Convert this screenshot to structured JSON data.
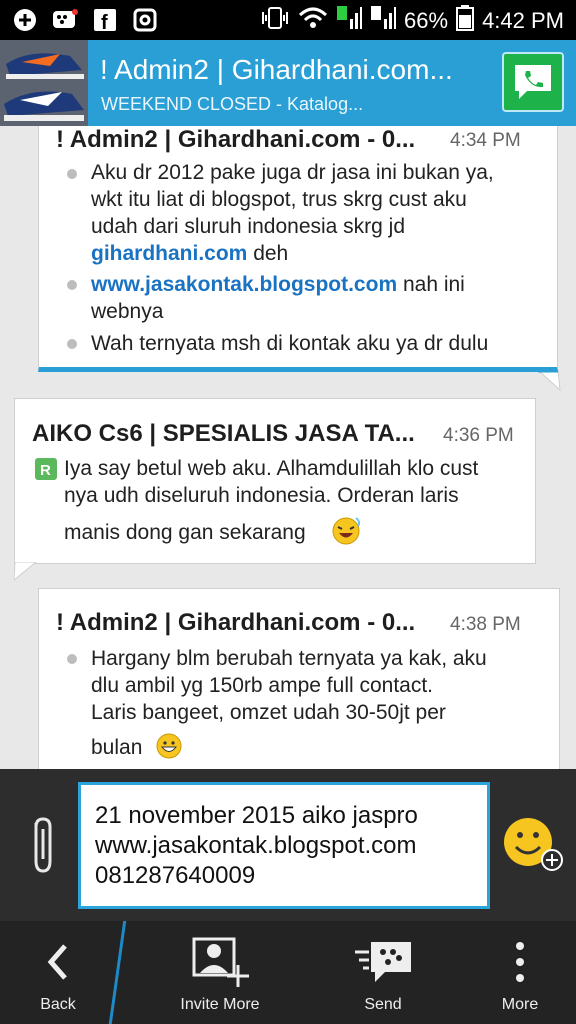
{
  "status_bar": {
    "battery": "66%",
    "time": "4:42 PM"
  },
  "header": {
    "title": "! Admin2 | Gihardhani.com...",
    "subtitle": "WEEKEND CLOSED - Katalog..."
  },
  "messages": [
    {
      "sender": "! Admin2 | Gihardhani.com - 0...",
      "time": "4:34 PM",
      "lines": [
        {
          "bullet": true,
          "text": "Aku dr 2012 pake juga dr jasa ini bukan ya,"
        },
        {
          "bullet": false,
          "text": "wkt itu liat di blogspot, trus skrg cust aku"
        },
        {
          "bullet": false,
          "text": "udah dari sluruh indonesia skrg jd"
        },
        {
          "bullet": false,
          "link": "gihardhani.com",
          "text": " deh"
        },
        {
          "bullet": true,
          "link": "www.jasakontak.blogspot.com",
          "text": " nah ini"
        },
        {
          "bullet": false,
          "text": "webnya"
        },
        {
          "bullet": true,
          "text": "Wah ternyata msh di kontak aku ya dr dulu"
        }
      ]
    },
    {
      "sender": "AIKO Cs6 | SPESIALIS JASA TA...",
      "time": "4:36 PM",
      "lines": [
        {
          "text": "Iya say betul web aku. Alhamdulillah klo cust"
        },
        {
          "text": "nya udh diseluruh indonesia. Orderan laris"
        },
        {
          "text": "manis dong gan sekarang"
        }
      ]
    },
    {
      "sender": "! Admin2 | Gihardhani.com - 0...",
      "time": "4:38 PM",
      "lines": [
        {
          "bullet": true,
          "text": "Hargany blm berubah ternyata ya kak, aku"
        },
        {
          "bullet": false,
          "text": "dlu ambil yg 150rb ampe full contact."
        },
        {
          "bullet": false,
          "text": "Laris bangeet, omzet udah 30-50jt per"
        },
        {
          "bullet": false,
          "text": "bulan"
        }
      ]
    }
  ],
  "compose": {
    "lines": [
      "21 november 2015 aiko jaspro",
      "www.jasakontak.blogspot.com",
      "081287640009"
    ]
  },
  "bottom_nav": {
    "back": "Back",
    "invite": "Invite More",
    "send": "Send",
    "more": "More"
  },
  "colors": {
    "header": "#2a9fd6",
    "accent": "#1a73c2",
    "call": "#1db24a"
  }
}
